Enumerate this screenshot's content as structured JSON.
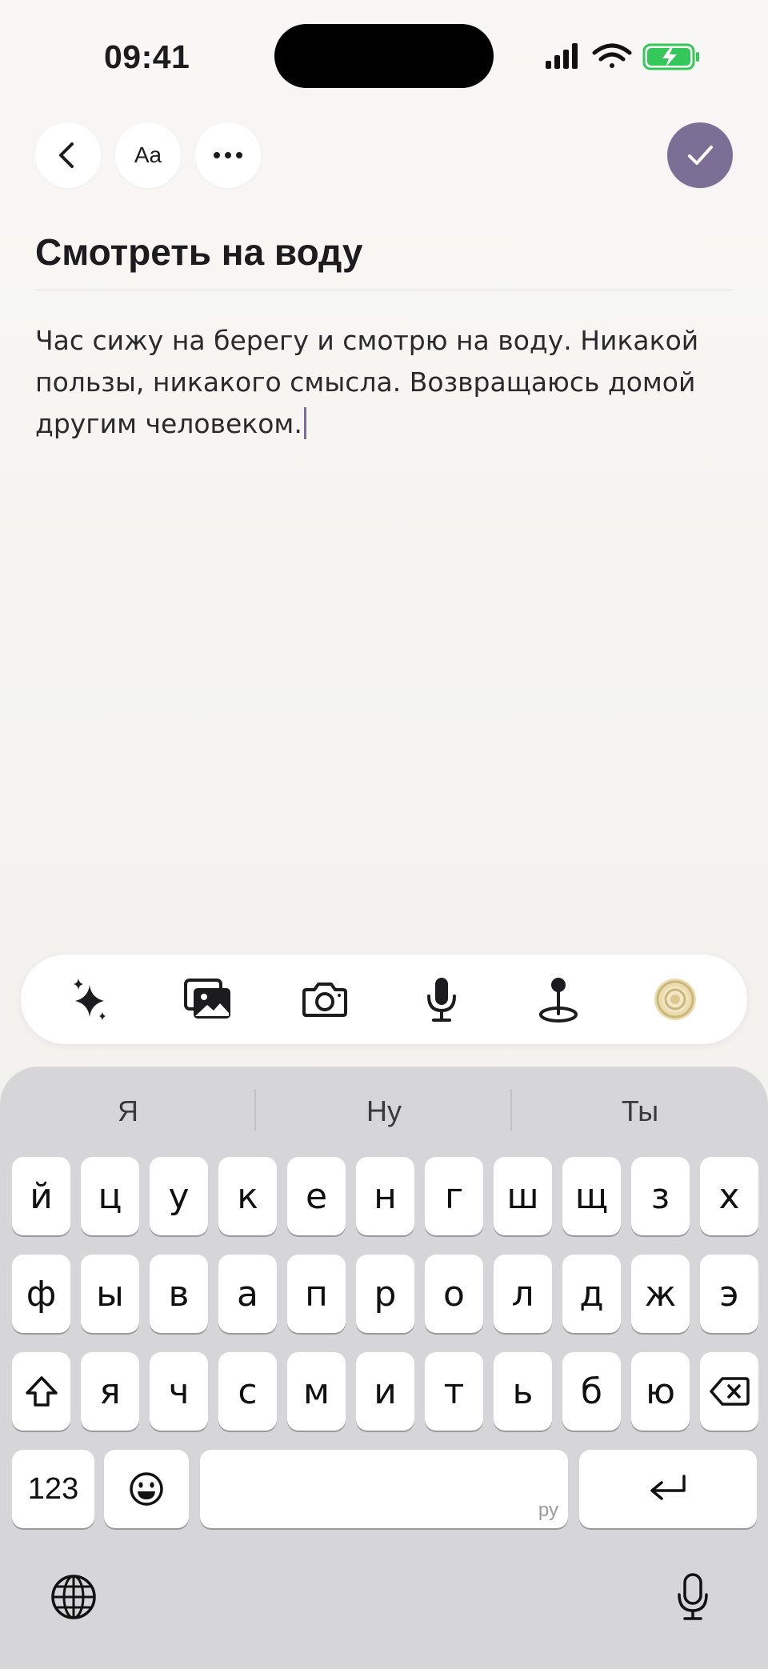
{
  "status_bar": {
    "time": "09:41"
  },
  "toolbar": {
    "font_label": "Aa"
  },
  "note": {
    "title": "Смотреть на воду",
    "body": "Час сижу на берегу и смотрю на воду. Никакой пользы, никакого смысла. Возвращаюсь домой другим человеком."
  },
  "accessory_bar": {
    "icons": [
      "sparkles-icon",
      "photo-library-icon",
      "camera-icon",
      "microphone-icon",
      "location-pin-icon",
      "mood-rings-icon"
    ]
  },
  "keyboard": {
    "suggestions": [
      "Я",
      "Ну",
      "Ты"
    ],
    "rows": [
      [
        "й",
        "ц",
        "у",
        "к",
        "е",
        "н",
        "г",
        "ш",
        "щ",
        "з",
        "х"
      ],
      [
        "ф",
        "ы",
        "в",
        "а",
        "п",
        "р",
        "о",
        "л",
        "д",
        "ж",
        "э"
      ],
      [
        "я",
        "ч",
        "с",
        "м",
        "и",
        "т",
        "ь",
        "б",
        "ю"
      ]
    ],
    "numbers_label": "123",
    "space_language_hint": "ру"
  },
  "colors": {
    "accent": "#7b6f95",
    "battery": "#34c759",
    "keyboard_bg": "#d6d6d8"
  }
}
